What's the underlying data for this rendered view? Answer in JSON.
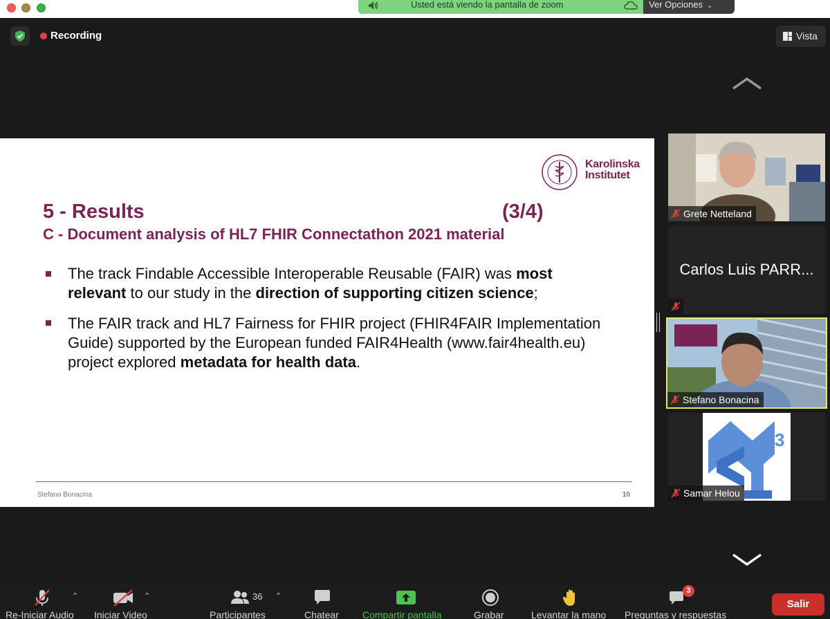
{
  "share_banner": {
    "text": "Usted está viendo la pantalla de zoom",
    "options_label": "Ver Opciones",
    "color": "#7ed37e"
  },
  "meeting": {
    "recording_label": "Recording",
    "view_label": "Vista",
    "recording_color": "#e0413a"
  },
  "slide": {
    "logo_line1": "Karolinska",
    "logo_line2": "Institutet",
    "title": "5 - Results",
    "page": "(3/4)",
    "subtitle": "C - Document analysis of HL7 FHIR Connectathon 2021 material",
    "bullet1": {
      "t1": "The track Findable Accessible Interoperable Reusable (FAIR) was ",
      "b1": "most relevant",
      "t2": " to our study in the ",
      "b2": "direction of supporting citizen science",
      "t3": ";"
    },
    "bullet2": {
      "t1": "The FAIR track and HL7 Fairness for FHIR project (FHIR4FAIR Implementation Guide) supported by the European funded FAIR4Health (www.fair4health.eu) project explored ",
      "b1": "metadata for health data",
      "t2": "."
    },
    "author": "Stefano Bonacina",
    "number": "10",
    "accent_color": "#7a2356"
  },
  "participants": [
    {
      "name": "Grete Netteland",
      "muted": true
    },
    {
      "name": "Carlos Luis PARR...",
      "muted": true
    },
    {
      "name": "Stefano Bonacina",
      "muted": true,
      "active_speaker": true
    },
    {
      "name": "Samar Helou",
      "muted": true
    }
  ],
  "toolbar": {
    "audio_label": "Re-Iniciar Audio",
    "video_label": "Iniciar Video",
    "participants_label": "Participantes",
    "participants_count": "36",
    "chat_label": "Chatear",
    "share_label": "Compartir pantalla",
    "record_label": "Grabar",
    "raise_hand_label": "Levantar la mano",
    "qa_label": "Preguntas y respuestas",
    "qa_badge": "3",
    "leave_label": "Salir",
    "share_color": "#4ec24e",
    "leave_color": "#c8302a"
  }
}
